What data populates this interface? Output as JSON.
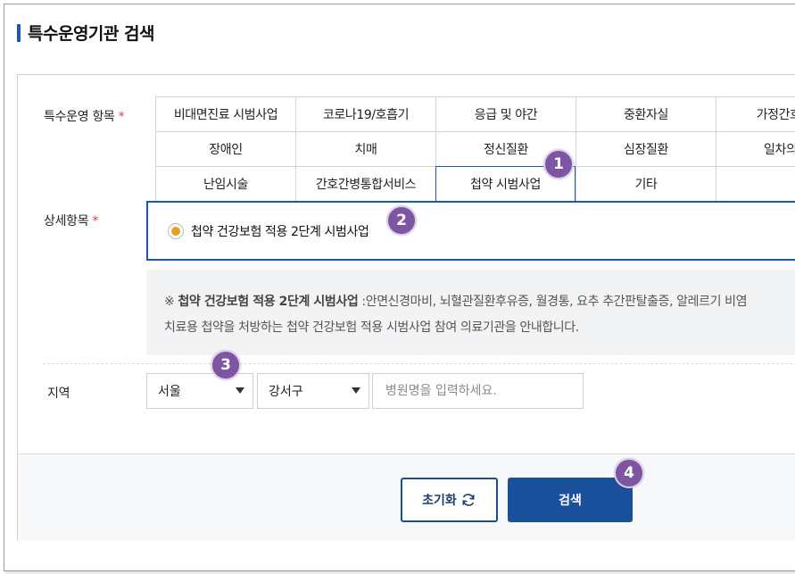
{
  "title": "특수운영기관 검색",
  "category_section": {
    "label": "특수운영 항목",
    "required_mark": "*",
    "rows": [
      [
        "비대면진료 시범사업",
        "코로나19/호흡기",
        "응급 및 야간",
        "중환자실",
        "가정간호/재"
      ],
      [
        "장애인",
        "치매",
        "정신질환",
        "심장질환",
        "일차의료"
      ],
      [
        "난임시술",
        "간호간병통합서비스",
        "첩약 시범사업",
        "기타",
        ""
      ]
    ],
    "selected": "첩약 시범사업"
  },
  "detail_section": {
    "label": "상세항목",
    "required_mark": "*",
    "option_label": "첩약 건강보험 적용 2단계 시범사업",
    "option_selected": true
  },
  "notice": {
    "prefix": "※ ",
    "bold": "첩약 건강보험 적용 2단계 시범사업",
    "line1_rest": " :안면신경마비, 뇌혈관질환후유증, 월경통, 요추 추간판탈출증, 알레르기 비염",
    "line2": "치료용 첩약을 처방하는 첩약 건강보험 적용 시범사업 참여 의료기관을 안내합니다."
  },
  "region": {
    "label": "지역",
    "city_value": "서울",
    "district_value": "강서구",
    "hospital_placeholder": "병원명을 입력하세요."
  },
  "buttons": {
    "reset_label": "초기화",
    "search_label": "검색"
  },
  "badges": [
    "1",
    "2",
    "3",
    "4"
  ],
  "colors": {
    "accent": "#1a57b6",
    "badge": "#7e55a3",
    "required": "#e8413a",
    "radio_dot": "#e8a020"
  }
}
